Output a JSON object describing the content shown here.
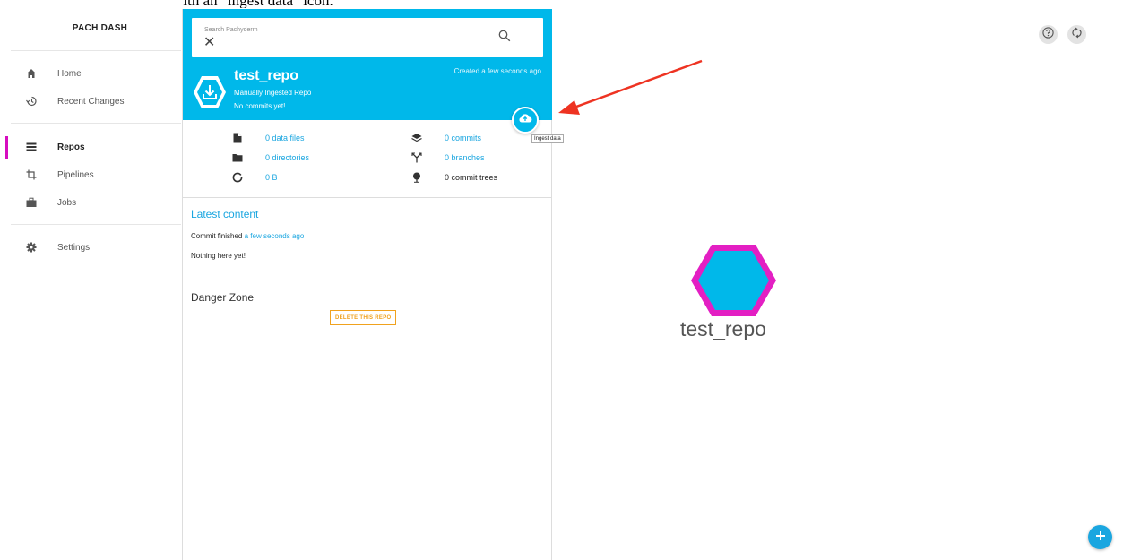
{
  "caption": "details about the repo along with an \"ingest data\" icon.",
  "sidebar": {
    "brand": "PACH DASH",
    "items": [
      {
        "label": "Home",
        "icon": "home-icon"
      },
      {
        "label": "Recent Changes",
        "icon": "history-icon"
      },
      {
        "label": "Repos",
        "icon": "list-icon",
        "active": true
      },
      {
        "label": "Pipelines",
        "icon": "crop-icon"
      },
      {
        "label": "Jobs",
        "icon": "briefcase-icon"
      },
      {
        "label": "Settings",
        "icon": "gear-icon"
      }
    ]
  },
  "search": {
    "placeholder": "Search Pachyderm"
  },
  "repo": {
    "name": "test_repo",
    "subtitle": "Manually Ingested Repo",
    "commits_note": "No commits yet!",
    "created": "Created a few seconds ago"
  },
  "tooltip": "Ingest data",
  "stats": {
    "data_files": "0 data files",
    "directories": "0 directories",
    "size": "0 B",
    "commits": "0 commits",
    "branches": "0 branches",
    "commit_trees": "0 commit trees"
  },
  "latest": {
    "heading": "Latest content",
    "commit_prefix": "Commit finished",
    "commit_time": "a few seconds ago",
    "empty": "Nothing here yet!"
  },
  "danger": {
    "heading": "Danger Zone",
    "delete_label": "DELETE THIS REPO"
  },
  "dag": {
    "node_label": "test_repo"
  },
  "colors": {
    "accent": "#00b8ea",
    "link": "#1aa6e0",
    "active_marker": "#d60dbf",
    "node_border": "#e31fc3",
    "node_fill": "#00b8ea",
    "danger": "#f0a21e",
    "arrow": "#ee3322"
  }
}
